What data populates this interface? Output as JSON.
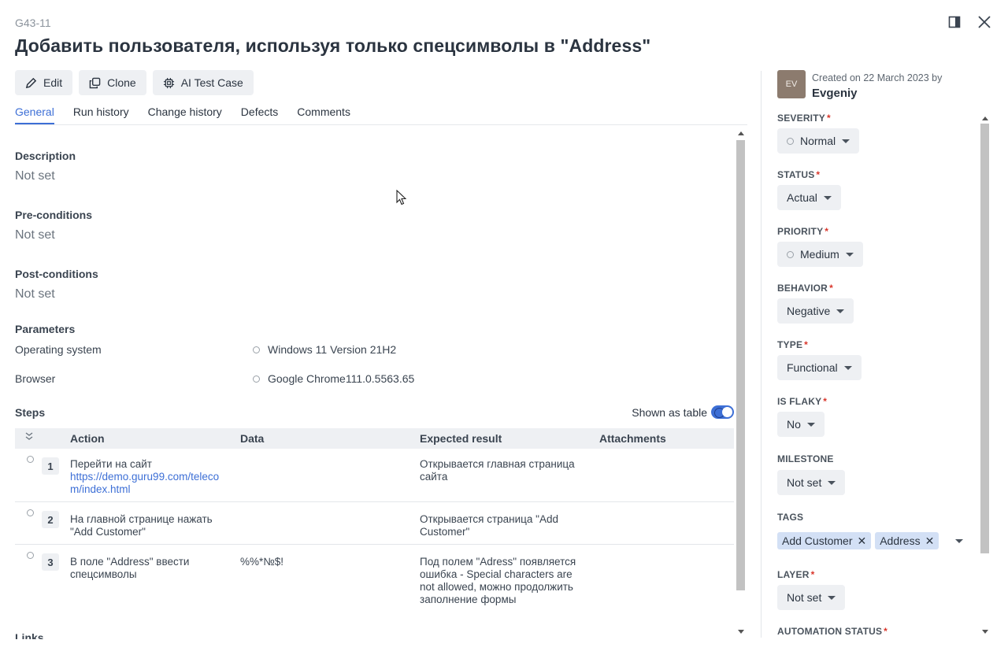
{
  "case": {
    "id": "G43-11",
    "title": "Добавить пользователя, используя только спецсимволы в \"Address\""
  },
  "toolbar": {
    "edit_label": "Edit",
    "clone_label": "Clone",
    "ai_label": "AI Test Case"
  },
  "tabs": [
    "General",
    "Run history",
    "Change history",
    "Defects",
    "Comments"
  ],
  "general": {
    "description_label": "Description",
    "description_value": "Not set",
    "preconditions_label": "Pre-conditions",
    "preconditions_value": "Not set",
    "postconditions_label": "Post-conditions",
    "postconditions_value": "Not set",
    "parameters_label": "Parameters",
    "parameters": [
      {
        "name": "Operating system",
        "value": "Windows 11 Version 21H2"
      },
      {
        "name": "Browser",
        "value": "Google Chrome111.0.5563.65"
      }
    ],
    "steps_label": "Steps",
    "shown_as_table_label": "Shown as table",
    "links_label": "Links"
  },
  "steps_table": {
    "headers": [
      "Action",
      "Data",
      "Expected result",
      "Attachments"
    ],
    "rows": [
      {
        "num": "1",
        "action": "Перейти на сайт",
        "action_link_1": "https://demo.guru99.com/teleco",
        "action_link_2": "m/index.html",
        "data": "",
        "expected_1": "Открывается главная страница",
        "expected_2": "сайта"
      },
      {
        "num": "2",
        "action_1": "На главной странице нажать",
        "action_2": "\"Add Customer\"",
        "data": "",
        "expected_1": "Открывается страница \"Add",
        "expected_2": "Customer\""
      },
      {
        "num": "3",
        "action_1": "В поле \"Address\" ввести",
        "action_2": "спецсимволы",
        "data": "%%*№$!",
        "expected_1": "Под полем \"Adress\" появляется",
        "expected_2": "ошибка - Special characters are",
        "expected_3": "not allowed, можно продолжить",
        "expected_4": "заполнение формы"
      }
    ]
  },
  "sidebar": {
    "avatar_initials": "EV",
    "created_text": "Created on 22 March 2023 by",
    "author": "Evgeniy",
    "fields": {
      "severity": {
        "label": "SEVERITY",
        "value": "Normal"
      },
      "status": {
        "label": "STATUS",
        "value": "Actual"
      },
      "priority": {
        "label": "PRIORITY",
        "value": "Medium"
      },
      "behavior": {
        "label": "BEHAVIOR",
        "value": "Negative"
      },
      "type": {
        "label": "TYPE",
        "value": "Functional"
      },
      "is_flaky": {
        "label": "IS FLAKY",
        "value": "No"
      },
      "milestone": {
        "label": "MILESTONE",
        "value": "Not set"
      },
      "tags": {
        "label": "TAGS",
        "values": [
          "Add Customer",
          "Address"
        ]
      },
      "layer": {
        "label": "LAYER",
        "value": "Not set"
      },
      "automation_status": {
        "label": "AUTOMATION STATUS"
      }
    },
    "required_mark": "*"
  },
  "colors": {
    "accent": "#3d6fd6",
    "required": "#d9362b",
    "tag_bg": "#d3e0f5",
    "button_bg": "#eef0f3"
  }
}
